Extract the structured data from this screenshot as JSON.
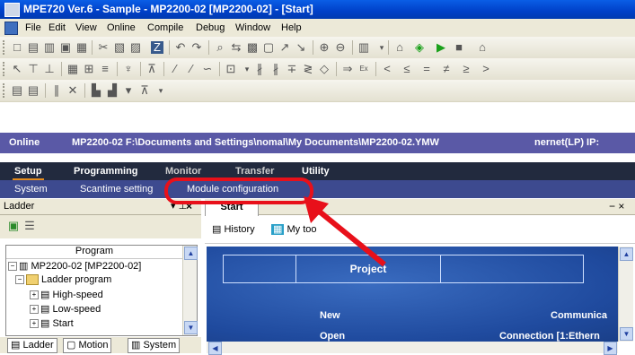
{
  "window": {
    "title": "MPE720 Ver.6 - Sample - MP2200-02 [MP2200-02] - [Start]"
  },
  "menu": {
    "items": [
      "File",
      "Edit",
      "View",
      "Online",
      "Compile",
      "Debug",
      "Window",
      "Help"
    ]
  },
  "online_bar": {
    "label": "Online",
    "path": "MP2200-02 F:\\Documents and Settings\\nomal\\My Documents\\MP2200-02.YMW",
    "connection": "nernet(LP) IP:"
  },
  "main_tabs": [
    "Setup",
    "Programming",
    "Monitor",
    "Transfer",
    "Utility"
  ],
  "sub_tabs": [
    "System",
    "Scantime setting",
    "Module configuration"
  ],
  "left_pane": {
    "title": "Ladder",
    "pin_icon": "pin-icon",
    "close_icon": "close-icon",
    "tree_header": "Program",
    "tree": {
      "root": "MP2200-02 [MP2200-02]",
      "ladder": "Ladder program",
      "high": "High-speed",
      "low": "Low-speed",
      "start": "Start"
    },
    "bottom_tabs": [
      "Ladder",
      "Motion",
      "System"
    ]
  },
  "right_pane": {
    "tab": "Start",
    "controls": "− ×",
    "history": "History",
    "mytools": "My too",
    "canvas": {
      "project": "Project",
      "new": "New",
      "open": "Open",
      "comm": "Communica",
      "conn": "Connection [1:Ethern"
    }
  },
  "annotation": {
    "color": "#e8101a"
  }
}
